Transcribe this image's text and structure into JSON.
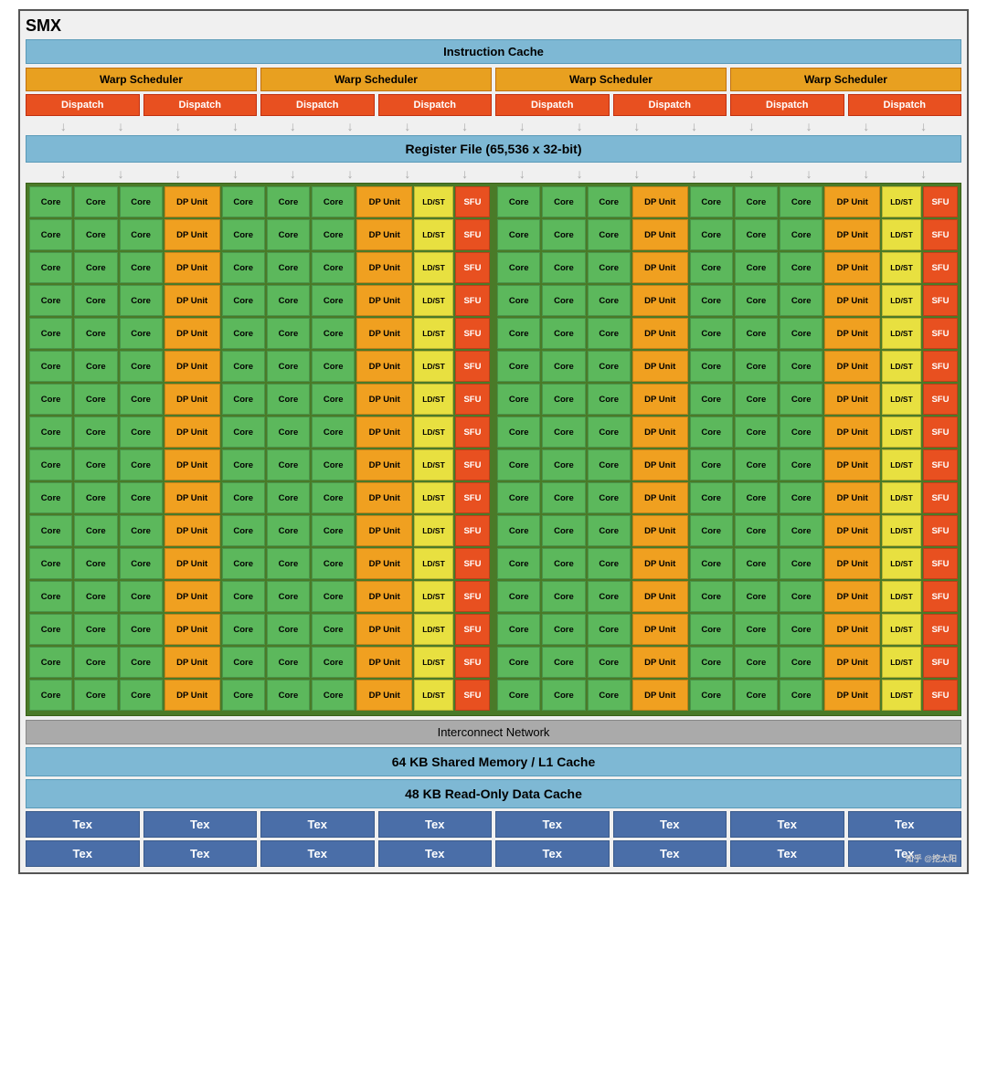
{
  "title": "SMX",
  "instruction_cache": "Instruction Cache",
  "warp_schedulers": [
    "Warp Scheduler",
    "Warp Scheduler",
    "Warp Scheduler",
    "Warp Scheduler"
  ],
  "dispatch_units": [
    "Dispatch",
    "Dispatch",
    "Dispatch",
    "Dispatch",
    "Dispatch",
    "Dispatch",
    "Dispatch",
    "Dispatch"
  ],
  "register_file": "Register File (65,536 x 32-bit)",
  "core_label": "Core",
  "dp_unit_label": "DP Unit",
  "ldst_label": "LD/ST",
  "sfu_label": "SFU",
  "num_rows": 16,
  "interconnect": "Interconnect Network",
  "shared_memory": "64 KB Shared Memory / L1 Cache",
  "readonly_cache": "48 KB Read-Only Data Cache",
  "tex_label": "Tex",
  "watermark": "知乎 @挖太阳",
  "colors": {
    "core": "#5cb85c",
    "dp_unit": "#f0a020",
    "ldst": "#e8e040",
    "sfu": "#e85020",
    "warp": "#e8a020",
    "dispatch": "#e85020",
    "cache": "#7eb8d4",
    "tex": "#4a6ea8",
    "bg_cores": "#4a7a28"
  }
}
